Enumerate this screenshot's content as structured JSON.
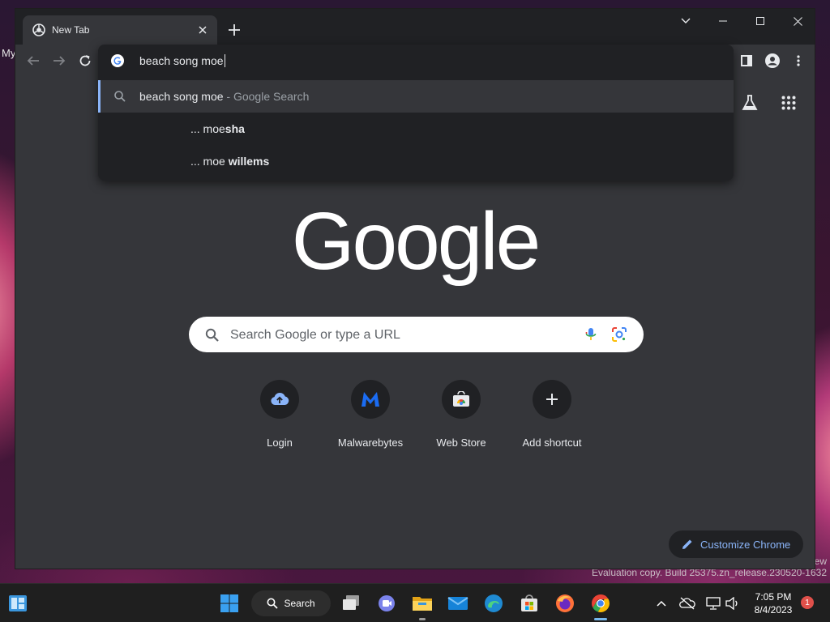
{
  "desktop": {
    "stub_text": "My",
    "watermark_line1": "ew",
    "watermark_line2": "Evaluation copy. Build 25375.zn_release.230520-1632"
  },
  "browser": {
    "tab": {
      "title": "New Tab",
      "favicon": "chrome-icon",
      "close_icon": "close-icon"
    },
    "new_tab_icon": "plus-icon",
    "window_controls": [
      "tab-search-chevron-icon",
      "minimize-icon",
      "maximize-icon",
      "close-icon"
    ],
    "toolbar": {
      "back_icon": "back-arrow-icon",
      "forward_icon": "forward-arrow-icon",
      "reload_icon": "reload-icon",
      "side_panel_icon": "side-panel-icon",
      "profile_icon": "profile-icon",
      "menu_icon": "kebab-menu-icon"
    },
    "omnibox": {
      "value": "beach song moe",
      "suggestions": [
        {
          "text": "beach song moe",
          "description": " - Google Search",
          "icon": "search-icon",
          "selected": true
        },
        {
          "prefix": "... moe",
          "bold": "sha",
          "selected": false
        },
        {
          "prefix": "... moe ",
          "bold": "willems",
          "selected": false
        }
      ]
    }
  },
  "ntp": {
    "labs_icon": "labs-flask-icon",
    "apps_icon": "apps-grid-icon",
    "logo_text": "Google",
    "search_placeholder": "Search Google or type a URL",
    "shortcuts": [
      {
        "label": "Login",
        "icon": "cloud-upload-icon",
        "color": "#8ab4f8"
      },
      {
        "label": "Malwarebytes",
        "icon": "malwarebytes-icon",
        "color": "#1b6cf2"
      },
      {
        "label": "Web Store",
        "icon": "web-store-icon",
        "color": "#e8eaed"
      },
      {
        "label": "Add shortcut",
        "icon": "plus-icon",
        "color": "#e8eaed"
      }
    ],
    "customize_label": "Customize Chrome"
  },
  "taskbar": {
    "search_label": "Search",
    "apps": [
      "start-icon",
      "search-icon",
      "task-view-icon",
      "teams-chat-icon",
      "file-explorer-icon",
      "mail-icon",
      "edge-icon",
      "store-icon",
      "firefox-icon",
      "chrome-icon"
    ],
    "tray": [
      "show-hidden-icons-chevron-icon",
      "onedrive-off-icon",
      "network-icon",
      "volume-icon"
    ],
    "time": "7:05 PM",
    "date": "8/4/2023",
    "notification_count": "1"
  },
  "colors": {
    "ntp_bg": "#35363a",
    "frame": "#202124",
    "accent_blue": "#8ab4f8",
    "text": "#e8eaed"
  }
}
